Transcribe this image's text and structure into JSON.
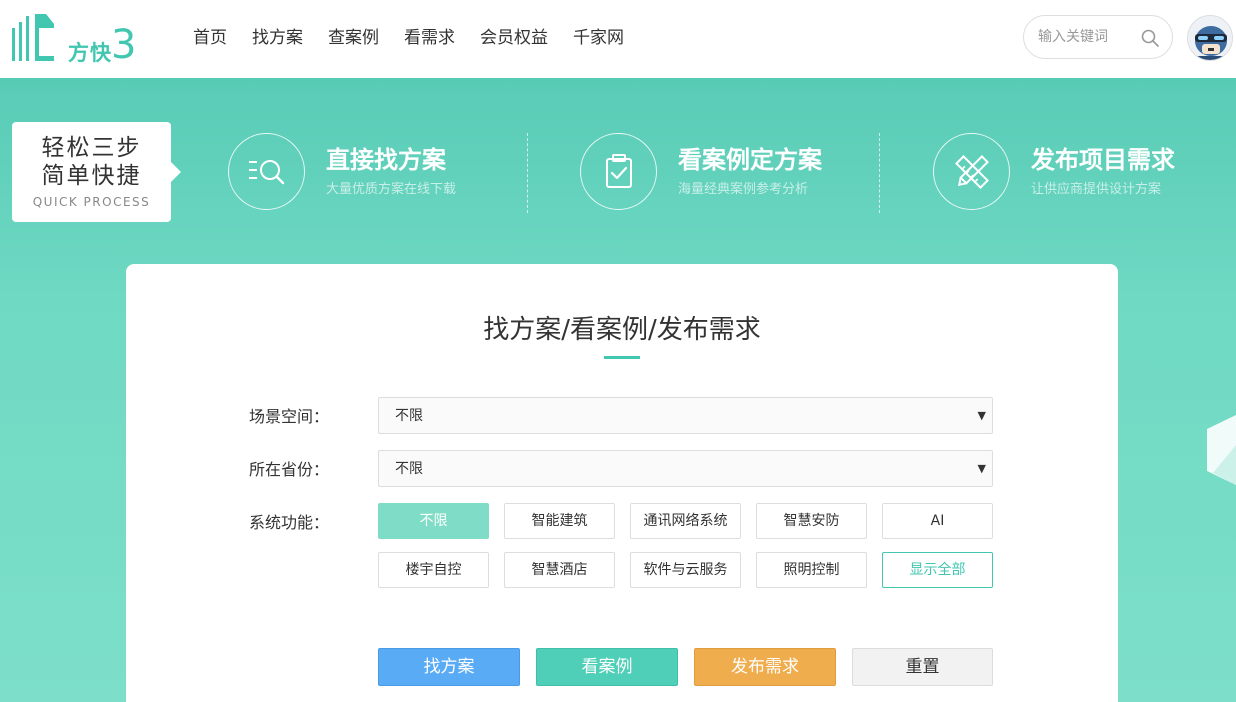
{
  "header": {
    "logo_text": "方快",
    "logo_num": "3",
    "nav": [
      "首页",
      "找方案",
      "查案例",
      "看需求",
      "会员权益",
      "千家网"
    ],
    "search_placeholder": "输入关键词"
  },
  "quick": {
    "line1": "轻松三步",
    "line2": "简单快捷",
    "en": "QUICK PROCESS"
  },
  "steps": [
    {
      "title": "直接找方案",
      "subtitle": "大量优质方案在线下载",
      "icon": "search-list-icon"
    },
    {
      "title": "看案例定方案",
      "subtitle": "海量经典案例参考分析",
      "icon": "clipboard-check-icon"
    },
    {
      "title": "发布项目需求",
      "subtitle": "让供应商提供设计方案",
      "icon": "pencil-ruler-icon"
    }
  ],
  "card": {
    "title": "找方案/看案例/发布需求",
    "scene_label": "场景空间：",
    "scene_value": "不限",
    "province_label": "所在省份：",
    "province_value": "不限",
    "system_label": "系统功能：",
    "tags": [
      "不限",
      "智能建筑",
      "通讯网络系统",
      "智慧安防",
      "AI",
      "楼宇自控",
      "智慧酒店",
      "软件与云服务",
      "照明控制",
      "显示全部"
    ],
    "buttons": {
      "find": "找方案",
      "case": "看案例",
      "publish": "发布需求",
      "reset": "重置"
    }
  },
  "colors": {
    "brand": "#41c6b0",
    "banner_top": "#58cbb6",
    "banner_bottom": "#7ddfc9",
    "btn_find": "#5aabf6",
    "btn_case": "#4fcfb8",
    "btn_publish": "#f0ad4e"
  }
}
